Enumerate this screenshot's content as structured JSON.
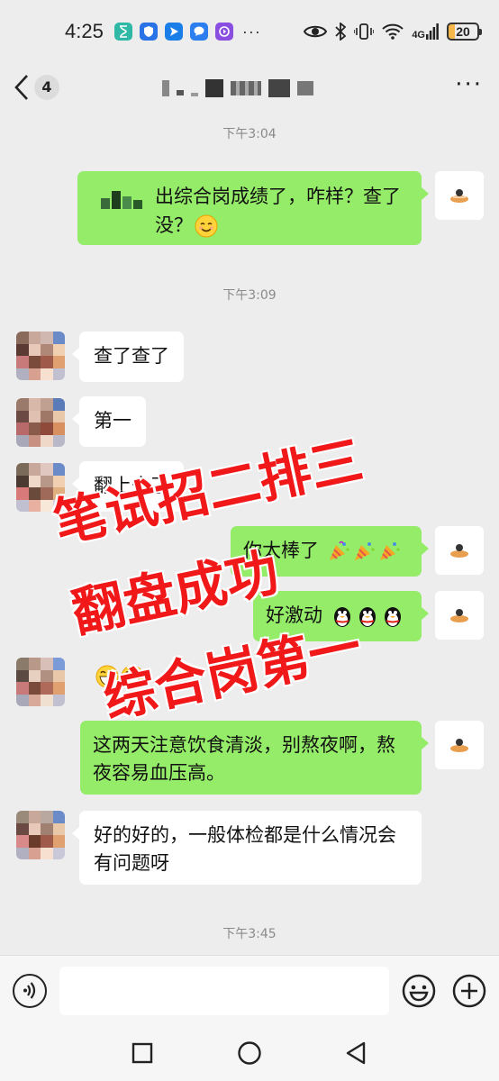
{
  "status_bar": {
    "time": "4:25",
    "battery_level": "20",
    "network": "4G",
    "more_indicator": "···"
  },
  "navbar": {
    "unread_count": "4",
    "title_redacted": true
  },
  "timestamps": [
    "下午3:04",
    "下午3:09",
    "下午3:45"
  ],
  "messages": [
    {
      "side": "right",
      "text": "出综合岗成绩了，咋样？查了没？",
      "emoji": "smiling-face"
    },
    {
      "side": "left",
      "text": "查了查了"
    },
    {
      "side": "left",
      "text": "第一"
    },
    {
      "side": "left",
      "text": "翻上去了"
    },
    {
      "side": "right",
      "text": "你太棒了",
      "emoji": "party-popper x3"
    },
    {
      "side": "right",
      "text": "好激动",
      "emoji": "penguin x3"
    },
    {
      "side": "left",
      "text": "",
      "emoji": "grinning-face x2"
    },
    {
      "side": "right",
      "text": "这两天注意饮食清淡，别熬夜啊，熬夜容易血压高。"
    },
    {
      "side": "left",
      "text": "好的好的，一般体检都是什么情况会有问题呀"
    }
  ],
  "overlay": {
    "line1": "笔试招二排三",
    "line2": "翻盘成功",
    "line3": "综合岗第一",
    "color": "#f01818"
  },
  "input": {
    "placeholder": ""
  },
  "colors": {
    "background": "#ededed",
    "my_bubble": "#95ec69",
    "their_bubble": "#ffffff"
  }
}
